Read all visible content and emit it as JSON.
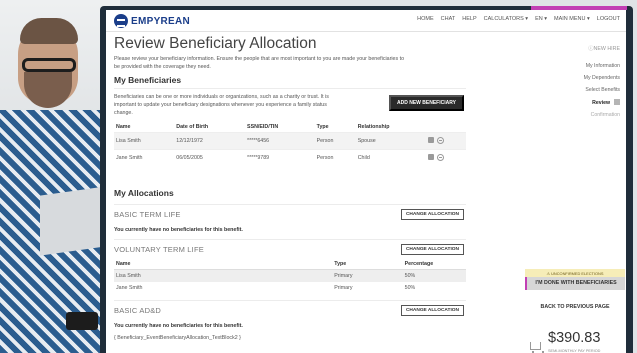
{
  "header": {
    "logo": "EMPYREAN",
    "nav": [
      "HOME",
      "CHAT",
      "HELP",
      "CALCULATORS ▾",
      "EN ▾",
      "MAIN MENU ▾",
      "LOGOUT"
    ]
  },
  "page": {
    "title": "Review Beneficiary Allocation",
    "intro": "Please review your beneficiary information. Ensure the people that are most important to you are made your beneficiaries to be provided with the coverage they need."
  },
  "beneficiaries": {
    "heading": "My Beneficiaries",
    "description": "Beneficiaries can be one or more individuals or organizations, such as a charity or trust. It is important to update your beneficiary designations whenever you experience a family status change.",
    "add_button": "ADD NEW BENEFICIARY",
    "columns": [
      "Name",
      "Date of Birth",
      "SSN/EID/TIN",
      "Type",
      "Relationship"
    ],
    "rows": [
      {
        "name": "Lisa Smith",
        "dob": "12/12/1972",
        "ssn": "*****6456",
        "type": "Person",
        "relationship": "Spouse"
      },
      {
        "name": "Jane Smith",
        "dob": "06/05/2005",
        "ssn": "*****9789",
        "type": "Person",
        "relationship": "Child"
      }
    ]
  },
  "allocations": {
    "heading": "My Allocations",
    "change_label": "CHANGE ALLOCATION",
    "no_bene_text": "You currently have no beneficiaries for this benefit.",
    "basic_term": {
      "name": "BASIC TERM LIFE"
    },
    "voluntary_term": {
      "name": "VOLUNTARY TERM LIFE",
      "columns": [
        "Name",
        "Type",
        "Percentage"
      ],
      "rows": [
        {
          "name": "Lisa Smith",
          "type": "Primary",
          "percentage": "50%"
        },
        {
          "name": "Jane Smith",
          "type": "Primary",
          "percentage": "50%"
        }
      ]
    },
    "basic_add": {
      "name": "BASIC AD&D"
    },
    "text_block": "{ Beneficiary_EventBeneficiaryAllocation_TextBlock2 }"
  },
  "sidebar": {
    "new_hire": "NEW HIRE",
    "steps": [
      "My Information",
      "My Dependents",
      "Select Benefits",
      "Review",
      "Confirmation"
    ],
    "current_step": "Review",
    "warning": "UNCONFIRMED ELECTIONS",
    "done_button": "I'M DONE WITH BENEFICIARIES",
    "back_link": "BACK TO PREVIOUS PAGE",
    "cost": "$390.83",
    "cost_period": "SEMI-MONTHLY PAY PERIOD"
  },
  "colors": {
    "brand": "#1b3e8a",
    "accent": "#c23fb4",
    "warning_bg": "#f6edb8"
  }
}
